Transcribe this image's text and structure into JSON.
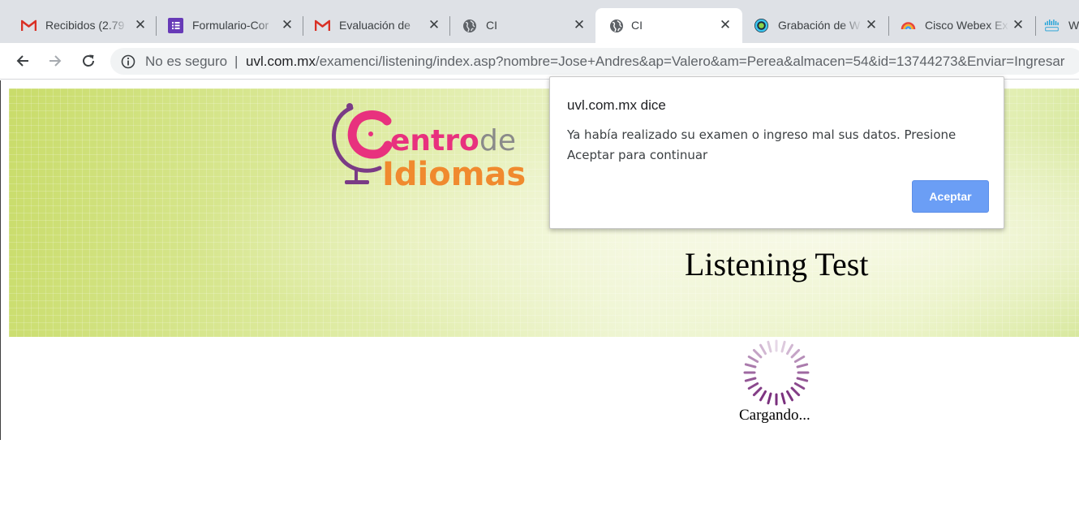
{
  "browser": {
    "tabs": [
      {
        "title": "Recibidos (2.79",
        "icon": "gmail-icon",
        "active": false
      },
      {
        "title": "Formulario-Cor",
        "icon": "google-forms-icon",
        "active": false
      },
      {
        "title": "Evaluación de",
        "icon": "gmail-icon",
        "active": false
      },
      {
        "title": "CI",
        "icon": "globe-icon",
        "active": false
      },
      {
        "title": "CI",
        "icon": "globe-icon",
        "active": true
      },
      {
        "title": "Grabación de W",
        "icon": "webex-icon",
        "active": false
      },
      {
        "title": "Cisco Webex Ex",
        "icon": "webex-meetings-icon",
        "active": false
      },
      {
        "title": "W",
        "icon": "cisco-icon",
        "active": false
      }
    ],
    "close_glyph": "✕",
    "omnibox": {
      "security_label": "No es seguro",
      "separator": "|",
      "url_host": "uvl.com.mx",
      "url_path": "/examenci/listening/index.asp?nombre=Jose+Andres&ap=Valero&am=Perea&almacen=54&id=13744273&Enviar=Ingresar"
    }
  },
  "page": {
    "logo": {
      "line1a": "C",
      "line1b": "entro",
      "line1c": "de",
      "line2": "Idiomas",
      "pink": "#e8317e",
      "orange": "#f08a2e",
      "purple": "#7a3b86",
      "gray": "#8a8a8a"
    },
    "title": "Listening Test",
    "loading_text": "Cargando...",
    "spinner_color": "#7a2f7d"
  },
  "dialog": {
    "title": "uvl.com.mx dice",
    "message": "Ya había realizado su examen o ingreso mal sus datos. Presione Aceptar para continuar",
    "ok_label": "Aceptar",
    "accent": "#6b9ef5"
  }
}
